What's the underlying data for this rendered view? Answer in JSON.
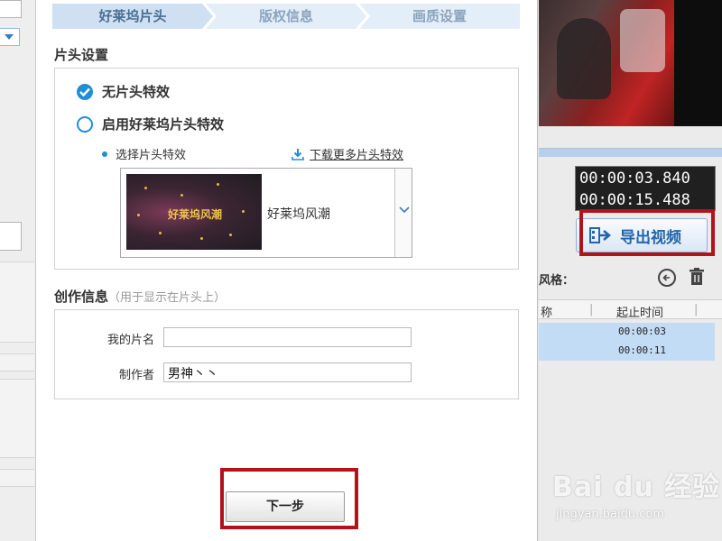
{
  "tabs": [
    {
      "label": "好莱坞片头",
      "active": true
    },
    {
      "label": "版权信息",
      "active": false
    },
    {
      "label": "画质设置",
      "active": false
    }
  ],
  "intro": {
    "section_title": "片头设置",
    "option_none": "无片头特效",
    "option_enable": "启用好莱坞片头特效",
    "select_label": "选择片头特效",
    "download_link": "下载更多片头特效",
    "effect_thumb_text": "好莱坞风潮",
    "effect_name": "好莱坞风潮"
  },
  "creation": {
    "section_title": "创作信息",
    "section_hint": "（用于显示在片头上）",
    "title_label": "我的片名",
    "title_value": "",
    "author_label": "制作者",
    "author_value": "男神丶丶"
  },
  "next_button": "下一步",
  "right_panel": {
    "time_current": "00:00:03.840",
    "time_total": "00:00:15.488",
    "export_button": "导出视频",
    "style_label": "风格：",
    "col_name": "称",
    "col_time": "起止时间",
    "row_start": "00:00:03",
    "row_end": "00:00:11"
  },
  "watermark": {
    "logo": "Bai du 经验",
    "url": "jingyan.baidu.com"
  },
  "colors": {
    "accent": "#1e8fd6",
    "highlight_border": "#b2131a",
    "tab_active": "#cfe0f2"
  }
}
